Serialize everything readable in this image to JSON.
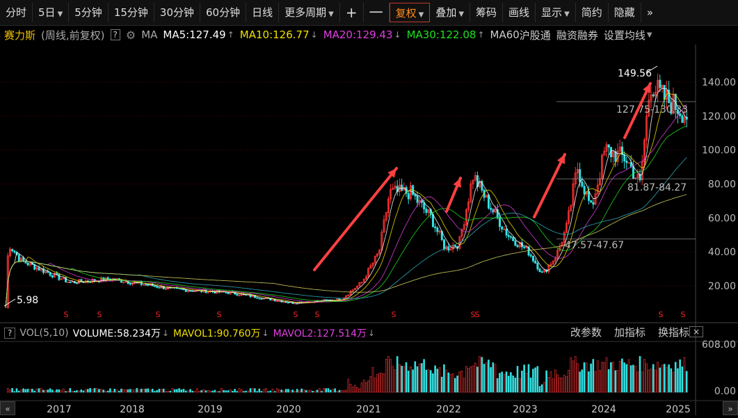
{
  "toolbar": {
    "items": [
      {
        "label": "分时",
        "caret": false
      },
      {
        "label": "5日",
        "caret": true
      },
      {
        "label": "5分钟",
        "caret": false
      },
      {
        "label": "15分钟",
        "caret": false
      },
      {
        "label": "30分钟",
        "caret": false
      },
      {
        "label": "60分钟",
        "caret": false
      },
      {
        "label": "日线",
        "caret": false
      },
      {
        "label": "更多周期",
        "caret": true
      },
      {
        "label": "+",
        "caret": false
      },
      {
        "label": "一",
        "caret": false
      },
      {
        "label": "复权",
        "caret": true
      },
      {
        "label": "叠加",
        "caret": true
      },
      {
        "label": "筹码",
        "caret": false
      },
      {
        "label": "画线",
        "caret": false
      },
      {
        "label": "显示",
        "caret": true
      },
      {
        "label": "简约",
        "caret": false
      },
      {
        "label": "隐藏",
        "caret": false
      }
    ],
    "more_icon": "»"
  },
  "info": {
    "stock_name": "赛力斯",
    "period": "(周线,前复权)",
    "help": "?",
    "ma_label": "MA",
    "ma5": "MA5:127.49",
    "ma10": "MA10:126.77",
    "ma20": "MA20:129.43",
    "ma30": "MA30:122.08",
    "ma60": "MA60",
    "hsgt": "沪股通",
    "margin": "融资融券",
    "settings": "设置均线"
  },
  "vol": {
    "help": "?",
    "label": "VOL(5,10)",
    "volume": "VOLUME:58.234万",
    "mavol1": "MAVOL1:90.760万",
    "mavol2": "MAVOL2:127.514万",
    "change_params": "改参数",
    "add_indicator": "加指标",
    "switch_indicator": "换指标",
    "close": "×"
  },
  "chart_data": {
    "type": "line",
    "title": "",
    "price_axis": {
      "ticks": [
        20,
        40,
        60,
        80,
        100,
        120,
        140
      ],
      "labels": [
        "20.00",
        "40.00",
        "60.00",
        "80.00",
        "100.00",
        "120.00",
        "140.00"
      ]
    },
    "volume_axis": {
      "labels": [
        "608.00",
        "0.00"
      ]
    },
    "x_axis": {
      "labels": [
        "2017",
        "2018",
        "2019",
        "2020",
        "2021",
        "2022",
        "2023",
        "2024",
        "2025"
      ]
    },
    "annotations": {
      "low": "5.98",
      "high": "149.56",
      "zone1": "127.75-130.33",
      "zone2": "81.87-84.27",
      "zone3": "47.57-47.67"
    },
    "series": [
      {
        "name": "MA5",
        "color": "#ffffff"
      },
      {
        "name": "MA10",
        "color": "#f0e000"
      },
      {
        "name": "MA20",
        "color": "#e040e0"
      },
      {
        "name": "MA30",
        "color": "#20e020"
      },
      {
        "name": "MA60",
        "color": "#30b0c0"
      }
    ],
    "ylim": [
      5,
      150
    ]
  },
  "colors": {
    "up": "#ff3333",
    "down": "#33e0e0",
    "arrow": "#ff4040",
    "accent": "#ff8a1c"
  },
  "scroll": {
    "left": "«",
    "right": "»"
  }
}
